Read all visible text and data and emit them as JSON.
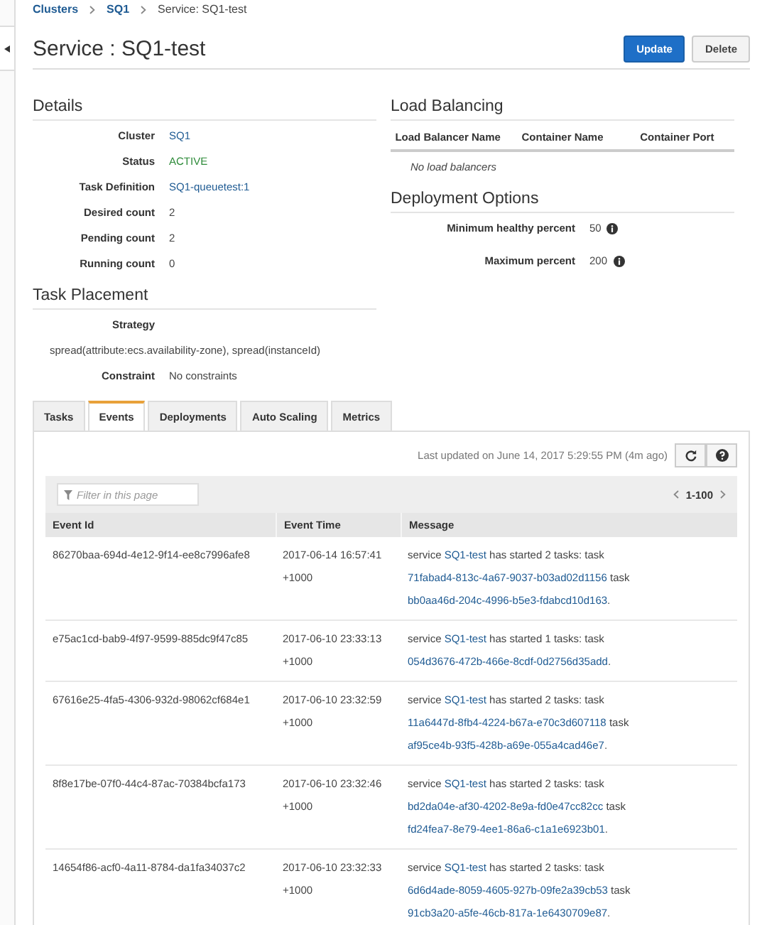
{
  "breadcrumb": [
    {
      "label": "Clusters",
      "link": true
    },
    {
      "label": "SQ1",
      "link": true
    },
    {
      "label": "Service: SQ1-test",
      "link": false
    }
  ],
  "title": "Service : SQ1-test",
  "actions": [
    {
      "label": "Update",
      "kind": "primary"
    },
    {
      "label": "Delete",
      "kind": "default"
    }
  ],
  "details": {
    "heading": "Details",
    "rows": [
      {
        "label": "Cluster",
        "value": "SQ1",
        "kind": "link"
      },
      {
        "label": "Status",
        "value": "ACTIVE",
        "kind": "status"
      },
      {
        "label": "Task Definition",
        "value": "SQ1-queuetest:1",
        "kind": "link"
      },
      {
        "label": "Desired count",
        "value": "2",
        "kind": "plain"
      },
      {
        "label": "Pending count",
        "value": "2",
        "kind": "plain"
      },
      {
        "label": "Running count",
        "value": "0",
        "kind": "plain"
      }
    ]
  },
  "load_balancing": {
    "heading": "Load Balancing",
    "columns": [
      "Load Balancer Name",
      "Container Name",
      "Container Port"
    ],
    "empty": "No load balancers"
  },
  "deployment_options": {
    "heading": "Deployment Options",
    "rows": [
      {
        "label": "Minimum healthy percent",
        "value": "50"
      },
      {
        "label": "Maximum percent",
        "value": "200"
      }
    ]
  },
  "task_placement": {
    "heading": "Task Placement",
    "strategy_label": "Strategy",
    "strategy": "spread(attribute:ecs.availability-zone), spread(instanceId)",
    "constraint_label": "Constraint",
    "constraint": "No constraints"
  },
  "tabs": [
    {
      "label": "Tasks",
      "selected": false
    },
    {
      "label": "Events",
      "selected": true
    },
    {
      "label": "Deployments",
      "selected": false
    },
    {
      "label": "Auto Scaling",
      "selected": false
    },
    {
      "label": "Metrics",
      "selected": false
    }
  ],
  "last_updated": "Last updated on June 14, 2017 5:29:55 PM (4m ago)",
  "filter": {
    "placeholder": "Filter in this page"
  },
  "pagination": "1-100",
  "table": {
    "columns": [
      "Event Id",
      "Event Time",
      "Message"
    ],
    "rows": [
      {
        "id": "86270baa-694d-4e12-9f14-ee8c7996afe8",
        "time": "2017-06-14 16:57:41 +1000",
        "message": [
          {
            "text": "service "
          },
          {
            "text": "SQ1-test",
            "link": true
          },
          {
            "text": " has started 2 tasks: task "
          },
          {
            "text": "71fabad4-813c-4a67-9037-b03ad02d1156",
            "link": true
          },
          {
            "text": " task "
          },
          {
            "text": "bb0aa46d-204c-4996-b5e3-fdabcd10d163",
            "link": true
          },
          {
            "text": "."
          }
        ]
      },
      {
        "id": "e75ac1cd-bab9-4f97-9599-885dc9f47c85",
        "time": "2017-06-10 23:33:13 +1000",
        "message": [
          {
            "text": "service "
          },
          {
            "text": "SQ1-test",
            "link": true
          },
          {
            "text": " has started 1 tasks: task "
          },
          {
            "text": "054d3676-472b-466e-8cdf-0d2756d35add",
            "link": true
          },
          {
            "text": "."
          }
        ]
      },
      {
        "id": "67616e25-4fa5-4306-932d-98062cf684e1",
        "time": "2017-06-10 23:32:59 +1000",
        "message": [
          {
            "text": "service "
          },
          {
            "text": "SQ1-test",
            "link": true
          },
          {
            "text": " has started 2 tasks: task "
          },
          {
            "text": "11a6447d-8fb4-4224-b67a-e70c3d607118",
            "link": true
          },
          {
            "text": " task "
          },
          {
            "text": "af95ce4b-93f5-428b-a69e-055a4cad46e7",
            "link": true
          },
          {
            "text": "."
          }
        ]
      },
      {
        "id": "8f8e17be-07f0-44c4-87ac-70384bcfa173",
        "time": "2017-06-10 23:32:46 +1000",
        "message": [
          {
            "text": "service "
          },
          {
            "text": "SQ1-test",
            "link": true
          },
          {
            "text": " has started 2 tasks: task "
          },
          {
            "text": "bd2da04e-af30-4202-8e9a-fd0e47cc82cc",
            "link": true
          },
          {
            "text": " task "
          },
          {
            "text": "fd24fea7-8e79-4ee1-86a6-c1a1e6923b01",
            "link": true
          },
          {
            "text": "."
          }
        ]
      },
      {
        "id": "14654f86-acf0-4a11-8784-da1fa34037c2",
        "time": "2017-06-10 23:32:33 +1000",
        "message": [
          {
            "text": "service "
          },
          {
            "text": "SQ1-test",
            "link": true
          },
          {
            "text": " has started 2 tasks: task "
          },
          {
            "text": "6d6d4ade-8059-4605-927b-09fe2a39cb53",
            "link": true
          },
          {
            "text": " task "
          },
          {
            "text": "91cb3a20-a5fe-46cb-817a-1e6430709e87",
            "link": true
          },
          {
            "text": "."
          }
        ]
      }
    ]
  }
}
